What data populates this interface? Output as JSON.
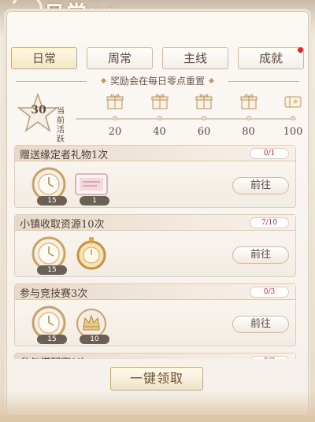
{
  "title": {
    "main": "日常",
    "sub": "任务"
  },
  "tabs": [
    {
      "label": "日常",
      "active": true
    },
    {
      "label": "周常",
      "active": false
    },
    {
      "label": "主线",
      "active": false
    },
    {
      "label": "成就",
      "active": false,
      "badge": true
    }
  ],
  "notice": "奖励会在每日零点重置",
  "activity": {
    "current": "30",
    "label": "当前活跃",
    "milestones": [
      "20",
      "40",
      "60",
      "80",
      "100"
    ],
    "progress_fraction": 0.3
  },
  "tasks": [
    {
      "name": "赠送缘定者礼物1次",
      "count": "0/1",
      "rewards": [
        {
          "icon": "clock-coin-icon",
          "qty": "15"
        },
        {
          "icon": "ticket-icon",
          "qty": "1"
        }
      ],
      "button": "前往"
    },
    {
      "name": "小镇收取资源10次",
      "count": "7/10",
      "rewards": [
        {
          "icon": "clock-coin-icon",
          "qty": "15"
        },
        {
          "icon": "gold-pocketwatch-icon",
          "qty": ""
        }
      ],
      "button": "前往"
    },
    {
      "name": "参与竞技赛3次",
      "count": "0/3",
      "rewards": [
        {
          "icon": "clock-coin-icon",
          "qty": "15"
        },
        {
          "icon": "crown-emblem-icon",
          "qty": "10"
        }
      ],
      "button": "前往"
    },
    {
      "name": "参与搭配赛3次",
      "count": "0/3",
      "rewards": [],
      "button": "前往"
    }
  ],
  "claim_all": "一键领取",
  "colors": {
    "accent_red": "#e0232a",
    "gold": "#c9a96e"
  }
}
